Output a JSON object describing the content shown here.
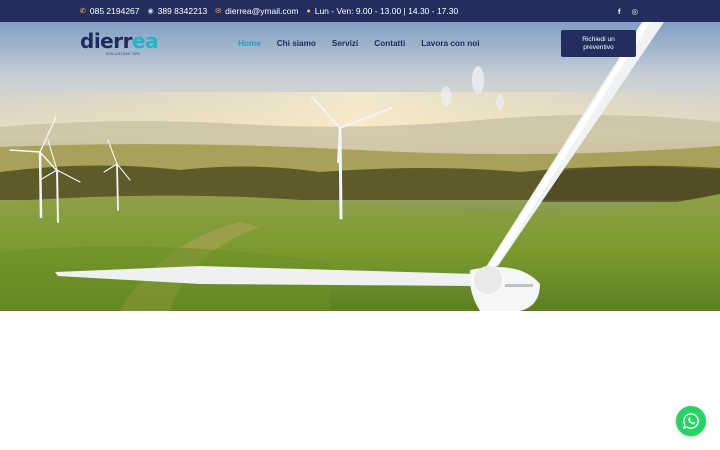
{
  "topbar": {
    "phone": "085 2194267",
    "whatsapp": "389 8342213",
    "email": "dierrea@ymail.com",
    "hours": "Lun - Ven: 9.00 - 13.00 | 14.30 - 17.30",
    "social": {
      "facebook": "f",
      "instagram": "◎"
    }
  },
  "header": {
    "logo_main": "dierr",
    "logo_accent": "ea",
    "logo_sub": "SOLUZIONI SRL",
    "nav": [
      {
        "label": "Home",
        "active": true
      },
      {
        "label": "Chi siamo"
      },
      {
        "label": "Servizi"
      },
      {
        "label": "Contatti"
      },
      {
        "label": "Lavora con noi"
      }
    ],
    "cta_line1": "Richiedi un",
    "cta_line2": "preventivo"
  },
  "colors": {
    "topbar": "#232e5e",
    "accent": "#1fa3b3",
    "whatsapp": "#25d366"
  },
  "icons": [
    "phone-icon",
    "whatsapp-icon",
    "mail-icon",
    "clock-icon",
    "facebook-icon",
    "instagram-icon",
    "whatsapp-fab-icon"
  ]
}
